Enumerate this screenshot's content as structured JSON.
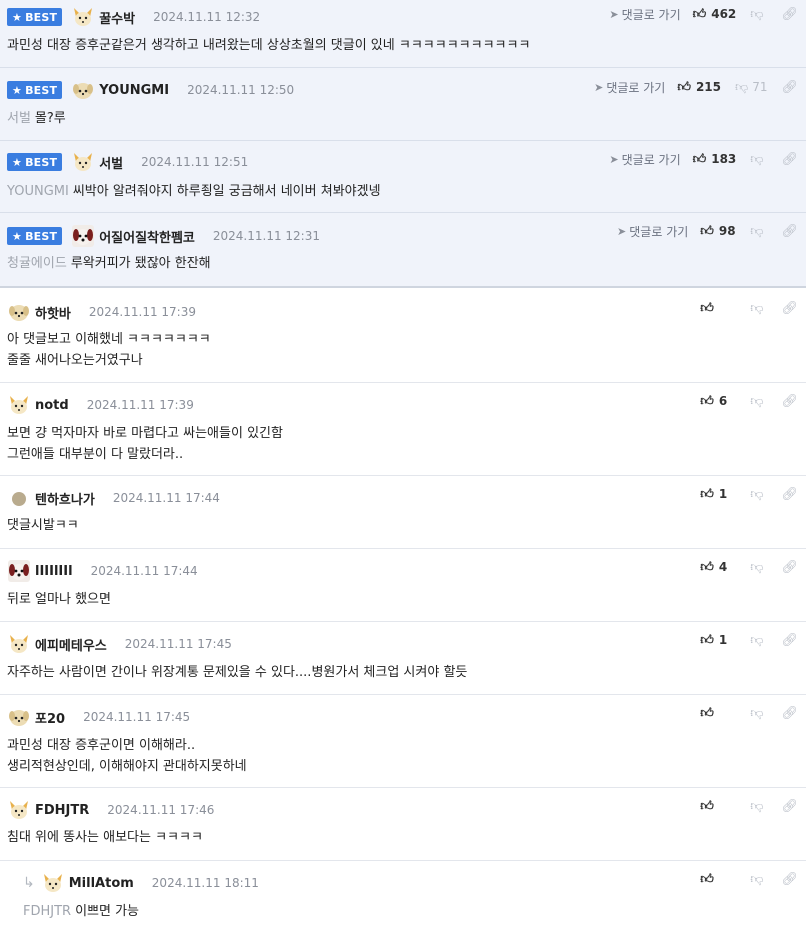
{
  "badge_label": "BEST",
  "reply_to_label": "댓글로 가기",
  "comments": [
    {
      "nick": "꿀수박",
      "date": "2024.11.11 12:32",
      "mention": "",
      "lines": [
        "과민성 대장 증후군같은거 생각하고 내려왔는데 상상초월의 댓글이 있네 ㅋㅋㅋㅋㅋㅋㅋㅋㅋㅋㅋ"
      ],
      "likes": "462",
      "dislikes": ""
    },
    {
      "nick": "YOUNGMI",
      "date": "2024.11.11 12:50",
      "mention": "서벌",
      "lines": [
        "몰?루"
      ],
      "likes": "215",
      "dislikes": "71"
    },
    {
      "nick": "서벌",
      "date": "2024.11.11 12:51",
      "mention": "YOUNGMI",
      "lines": [
        "씨박아 알려줘야지 하루죙일 궁금해서 네이버 쳐봐야겠넹"
      ],
      "likes": "183",
      "dislikes": ""
    },
    {
      "nick": "어질어질착한펨코",
      "date": "2024.11.11 12:31",
      "mention": "청귤에이드",
      "lines": [
        "루왁커피가 됐잖아 한잔해"
      ],
      "likes": "98",
      "dislikes": ""
    },
    {
      "nick": "하핫바",
      "date": "2024.11.11 17:39",
      "mention": "",
      "lines": [
        "아 댓글보고 이해했네 ㅋㅋㅋㅋㅋㅋㅋ",
        "줄줄 새어나오는거였구나"
      ],
      "likes": "",
      "dislikes": ""
    },
    {
      "nick": "notd",
      "date": "2024.11.11 17:39",
      "mention": "",
      "lines": [
        "보면 걍 먹자마자 바로 마렵다고 싸는애들이 있긴함",
        "그런애들 대부분이 다 말랐더라.."
      ],
      "likes": "6",
      "dislikes": ""
    },
    {
      "nick": "텐하흐나가",
      "date": "2024.11.11 17:44",
      "mention": "",
      "lines": [
        "댓글시발ㅋㅋ"
      ],
      "likes": "1",
      "dislikes": ""
    },
    {
      "nick": "lIIIlIIl",
      "date": "2024.11.11 17:44",
      "mention": "",
      "lines": [
        "뒤로 얼마나 했으면"
      ],
      "likes": "4",
      "dislikes": ""
    },
    {
      "nick": "에피메테우스",
      "date": "2024.11.11 17:45",
      "mention": "",
      "lines": [
        "자주하는 사람이면 간이나 위장계통 문제있을 수 있다....병원가서 체크업 시켜야 할듯"
      ],
      "likes": "1",
      "dislikes": ""
    },
    {
      "nick": "포20",
      "date": "2024.11.11 17:45",
      "mention": "",
      "lines": [
        "과민성 대장 증후군이면 이해해라..",
        "생리적현상인데, 이해해야지 관대하지못하네"
      ],
      "likes": "",
      "dislikes": ""
    },
    {
      "nick": "FDHJTR",
      "date": "2024.11.11 17:46",
      "mention": "",
      "lines": [
        "침대 위에 똥사는 애보다는 ㅋㅋㅋㅋ"
      ],
      "likes": "",
      "dislikes": ""
    },
    {
      "nick": "MillAtom",
      "date": "2024.11.11 18:11",
      "mention": "FDHJTR",
      "lines": [
        "이쁘면 가능"
      ],
      "likes": "",
      "dislikes": ""
    }
  ]
}
